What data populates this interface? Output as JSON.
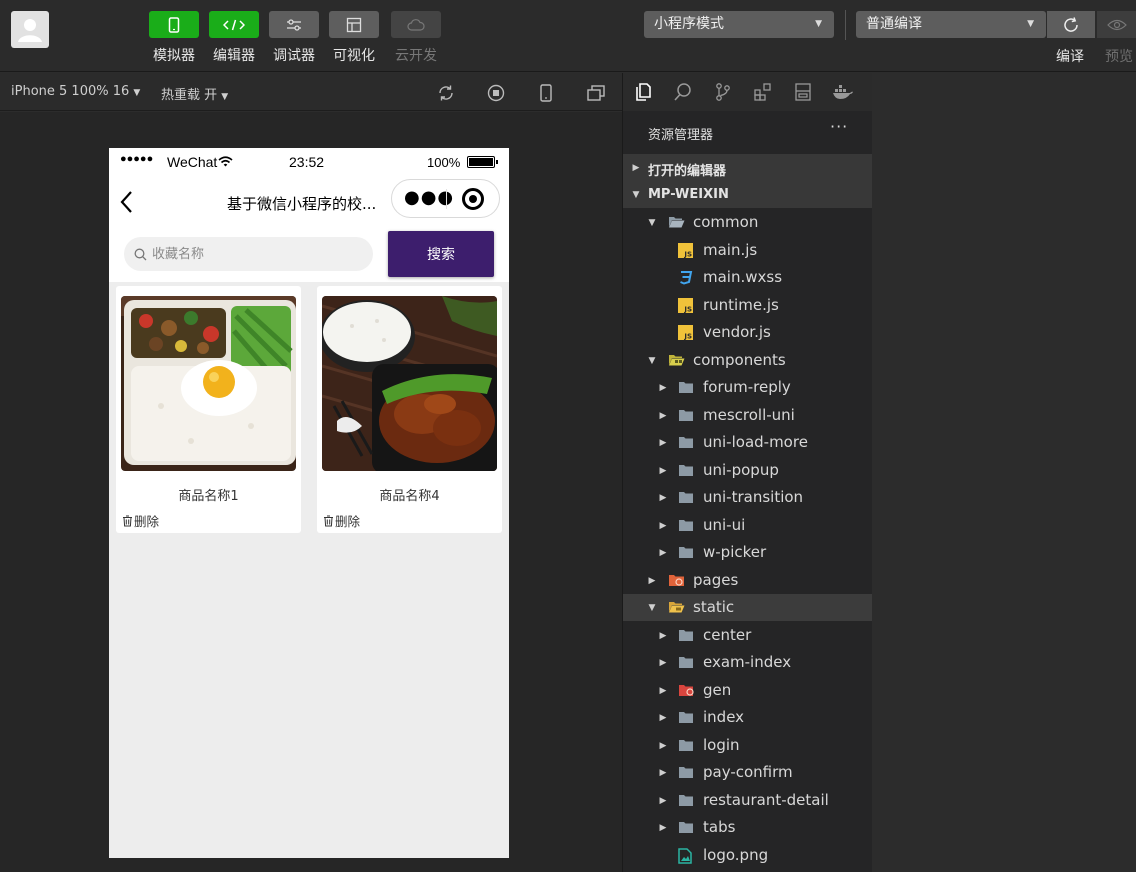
{
  "toolbar": {
    "tools": [
      {
        "label": "模拟器"
      },
      {
        "label": "编辑器"
      },
      {
        "label": "调试器"
      },
      {
        "label": "可视化"
      },
      {
        "label": "云开发"
      }
    ],
    "mode_select": "小程序模式",
    "compile_select": "普通编译",
    "compile_label": "编译",
    "preview_label": "预览"
  },
  "subbar": {
    "device": "iPhone 5 100% 16",
    "hot_reload": "热重载 开"
  },
  "phone": {
    "status": {
      "carrier": "WeChat",
      "time": "23:52",
      "battery": "100%"
    },
    "nav_title": "基于微信小程序的校...",
    "search_placeholder": "收藏名称",
    "search_button": "搜索",
    "items": [
      {
        "name": "商品名称1",
        "delete": "删除"
      },
      {
        "name": "商品名称4",
        "delete": "删除"
      }
    ]
  },
  "explorer": {
    "title": "资源管理器",
    "more": "···",
    "sections": {
      "open_editors": "打开的编辑器",
      "project": "MP-WEIXIN"
    },
    "tree": {
      "common": "common",
      "main_js": "main.js",
      "main_wxss": "main.wxss",
      "runtime_js": "runtime.js",
      "vendor_js": "vendor.js",
      "components": "components",
      "forum_reply": "forum-reply",
      "mescroll": "mescroll-uni",
      "load_more": "uni-load-more",
      "popup": "uni-popup",
      "transition": "uni-transition",
      "uni_ui": "uni-ui",
      "w_picker": "w-picker",
      "pages": "pages",
      "static": "static",
      "center": "center",
      "exam_index": "exam-index",
      "gen": "gen",
      "index": "index",
      "login": "login",
      "pay_confirm": "pay-confirm",
      "restaurant_detail": "restaurant-detail",
      "tabs": "tabs",
      "logo": "logo.png"
    }
  },
  "colors": {
    "accent_green": "#1aad19",
    "search_button": "#3d1e6d"
  }
}
